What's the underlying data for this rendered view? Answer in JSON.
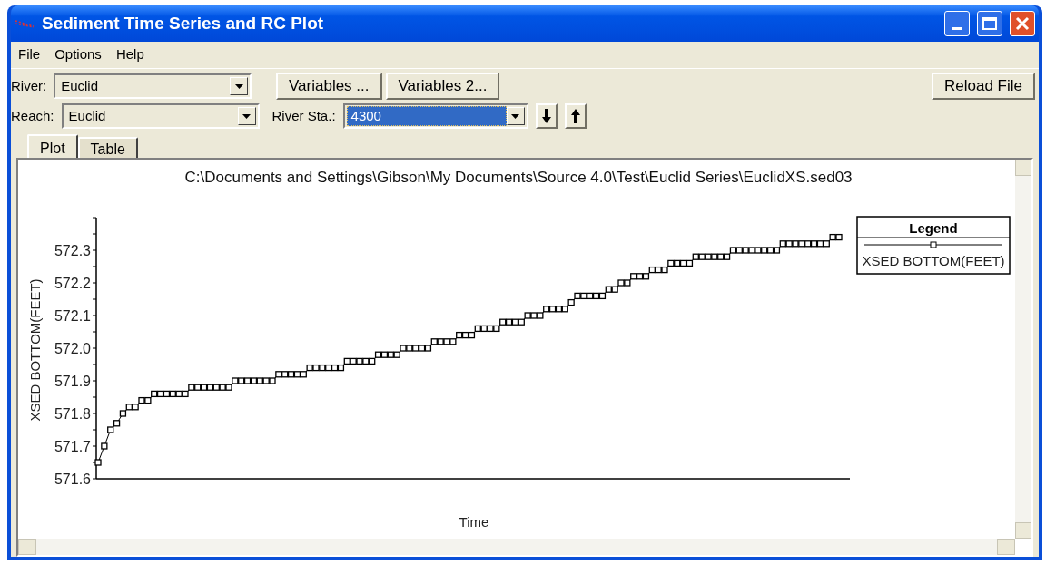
{
  "window": {
    "title": "Sediment Time Series and RC Plot"
  },
  "menu": [
    {
      "label": "File"
    },
    {
      "label": "Options"
    },
    {
      "label": "Help"
    }
  ],
  "selectors": {
    "river": {
      "label": "River:",
      "value": "Euclid"
    },
    "reach": {
      "label": "Reach:",
      "value": "Euclid"
    },
    "variable_buttons": [
      "Variables ...",
      "Variables 2..."
    ],
    "river_station": {
      "label": "River Sta.:",
      "value": "4300",
      "highlighted": true
    },
    "reload_button": "Reload File"
  },
  "tabs": [
    {
      "label": "Plot",
      "selected": true
    },
    {
      "label": "Table",
      "selected": false
    }
  ],
  "plot": {
    "legend_title": "Legend",
    "chart_data": {
      "type": "line",
      "title": "C:\\Documents and Settings\\Gibson\\My Documents\\Source 4.0\\Test\\Euclid Series\\EuclidXS.sed03",
      "xlabel": "Time",
      "ylabel": "XSED BOTTOM(FEET)",
      "ylim": [
        571.6,
        572.4
      ],
      "yticks": [
        {
          "value": 571.6,
          "label": "571.6"
        },
        {
          "value": 571.7,
          "label": "571.7"
        },
        {
          "value": 571.8,
          "label": "571.8"
        },
        {
          "value": 571.9,
          "label": "571.9"
        },
        {
          "value": 572.0,
          "label": "572.0"
        },
        {
          "value": 572.1,
          "label": "572.1"
        },
        {
          "value": 572.2,
          "label": "572.2"
        },
        {
          "value": 572.3,
          "label": "572.3"
        }
      ],
      "series": [
        {
          "name": "XSED BOTTOM(FEET)",
          "color": "#000000",
          "marker": "square",
          "values": [
            571.65,
            571.7,
            571.75,
            571.77,
            571.8,
            571.82,
            571.82,
            571.84,
            571.84,
            571.86,
            571.86,
            571.86,
            571.86,
            571.86,
            571.86,
            571.88,
            571.88,
            571.88,
            571.88,
            571.88,
            571.88,
            571.88,
            571.9,
            571.9,
            571.9,
            571.9,
            571.9,
            571.9,
            571.9,
            571.92,
            571.92,
            571.92,
            571.92,
            571.92,
            571.94,
            571.94,
            571.94,
            571.94,
            571.94,
            571.94,
            571.96,
            571.96,
            571.96,
            571.96,
            571.96,
            571.98,
            571.98,
            571.98,
            571.98,
            572.0,
            572.0,
            572.0,
            572.0,
            572.0,
            572.02,
            572.02,
            572.02,
            572.02,
            572.04,
            572.04,
            572.04,
            572.06,
            572.06,
            572.06,
            572.06,
            572.08,
            572.08,
            572.08,
            572.08,
            572.1,
            572.1,
            572.1,
            572.12,
            572.12,
            572.12,
            572.12,
            572.14,
            572.16,
            572.16,
            572.16,
            572.16,
            572.16,
            572.18,
            572.18,
            572.2,
            572.2,
            572.22,
            572.22,
            572.22,
            572.24,
            572.24,
            572.24,
            572.26,
            572.26,
            572.26,
            572.26,
            572.28,
            572.28,
            572.28,
            572.28,
            572.28,
            572.28,
            572.3,
            572.3,
            572.3,
            572.3,
            572.3,
            572.3,
            572.3,
            572.3,
            572.32,
            572.32,
            572.32,
            572.32,
            572.32,
            572.32,
            572.32,
            572.32,
            572.34,
            572.34
          ]
        }
      ]
    }
  }
}
